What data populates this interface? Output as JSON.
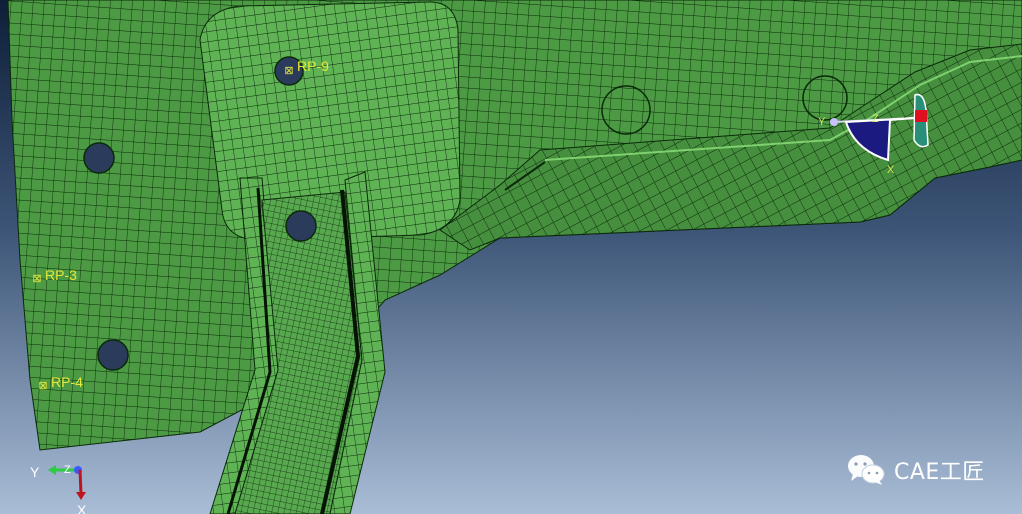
{
  "viewport": {
    "background_top": "#0e1f38",
    "background_bottom": "#a9bdd6",
    "mesh_fill": "#4c9a44",
    "mesh_line": "#0b2a0a",
    "hole_fill": "#2a3b5c"
  },
  "reference_points": [
    {
      "id": "rp9",
      "label": "RP-9"
    },
    {
      "id": "rp3",
      "label": "RP-3"
    },
    {
      "id": "rp4",
      "label": "RP-4"
    }
  ],
  "local_csys": {
    "axis_y": "Y",
    "axis_z": "Z",
    "axis_x": "X",
    "icon": "local-coordinate-system-icon"
  },
  "view_triad": {
    "axis_y": "Y",
    "axis_z": "Z",
    "axis_x": "X",
    "color_y": "#2ecc40",
    "color_z": "#3b5bff",
    "color_x": "#c0141e"
  },
  "watermark": {
    "text": "CAE工匠",
    "icon": "wechat-icon"
  }
}
